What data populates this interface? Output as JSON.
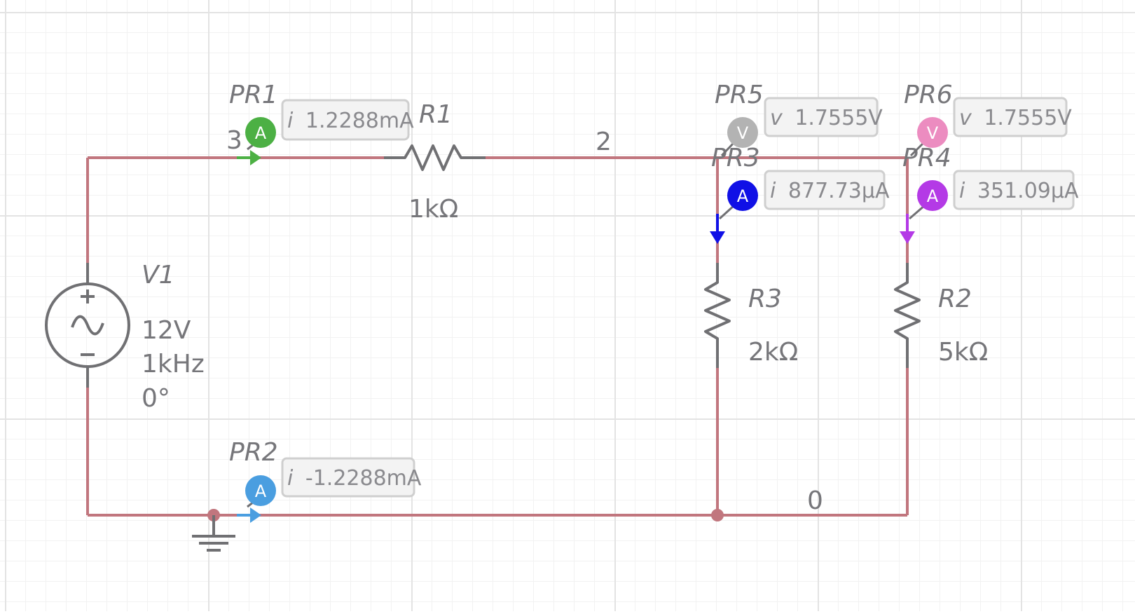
{
  "components": {
    "V1": {
      "name": "V1",
      "voltage": "12V",
      "frequency": "1kHz",
      "phase": "0°"
    },
    "R1": {
      "name": "R1",
      "value": "1kΩ"
    },
    "R2": {
      "name": "R2",
      "value": "5kΩ"
    },
    "R3": {
      "name": "R3",
      "value": "2kΩ"
    }
  },
  "nodes": {
    "n3": "3",
    "n2": "2",
    "n0": "0"
  },
  "probes": {
    "PR1": {
      "name": "PR1",
      "kind": "A",
      "prefix": "i",
      "reading": "1.2288mA",
      "color": "#4cb044"
    },
    "PR2": {
      "name": "PR2",
      "kind": "A",
      "prefix": "i",
      "reading": "-1.2288mA",
      "color": "#4a9ee0"
    },
    "PR3": {
      "name": "PR3",
      "kind": "A",
      "prefix": "i",
      "reading": "877.73µA",
      "color": "#1010e6"
    },
    "PR4": {
      "name": "PR4",
      "kind": "A",
      "prefix": "i",
      "reading": "351.09µA",
      "color": "#b43ae6"
    },
    "PR5": {
      "name": "PR5",
      "kind": "V",
      "prefix": "v",
      "reading": "1.7555V",
      "color": "#b3b3b3"
    },
    "PR6": {
      "name": "PR6",
      "kind": "V",
      "prefix": "v",
      "reading": "1.7555V",
      "color": "#ec8cc0"
    }
  },
  "colors": {
    "wire": "#c1767e",
    "component": "#707073",
    "label": "#76767a",
    "grid": "#e3e3e3"
  }
}
